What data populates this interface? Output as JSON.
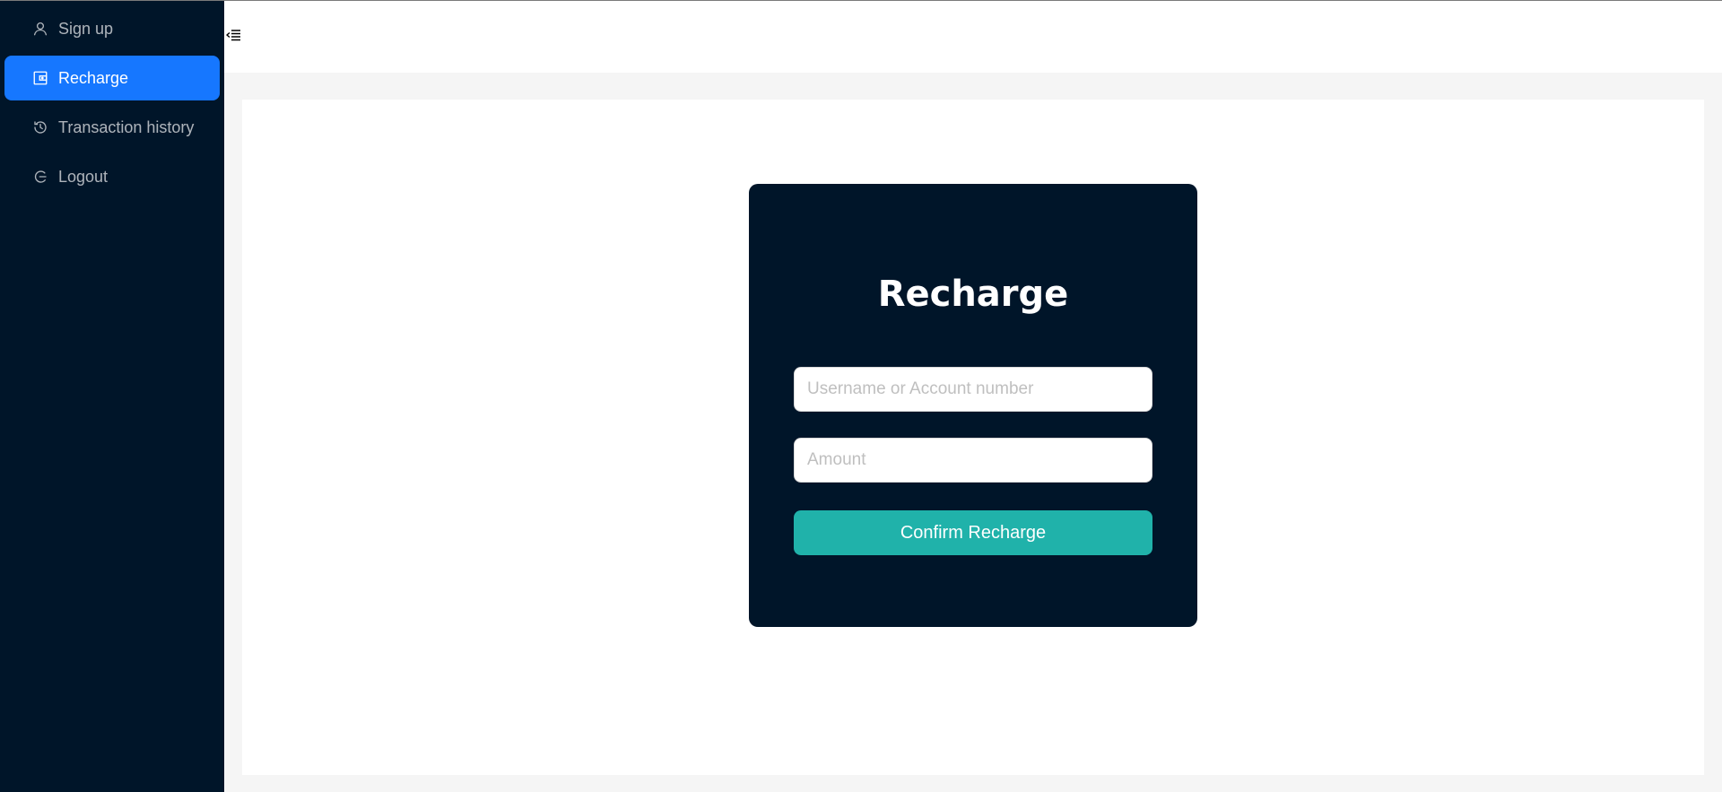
{
  "sidebar": {
    "items": [
      {
        "label": "Sign up",
        "icon": "user-icon",
        "active": false
      },
      {
        "label": "Recharge",
        "icon": "wallet-icon",
        "active": true
      },
      {
        "label": "Transaction history",
        "icon": "clock-history-icon",
        "active": false
      },
      {
        "label": "Logout",
        "icon": "logout-icon",
        "active": false
      }
    ]
  },
  "header": {
    "collapse_icon": "menu-fold-icon"
  },
  "recharge_form": {
    "title": "Recharge",
    "username_placeholder": "Username or Account number",
    "username_value": "",
    "amount_placeholder": "Amount",
    "amount_value": "",
    "confirm_label": "Confirm Recharge"
  },
  "colors": {
    "sidebar_bg": "#001529",
    "active_item": "#1677ff",
    "confirm_button": "#20b2aa",
    "card_bg": "#001529"
  }
}
